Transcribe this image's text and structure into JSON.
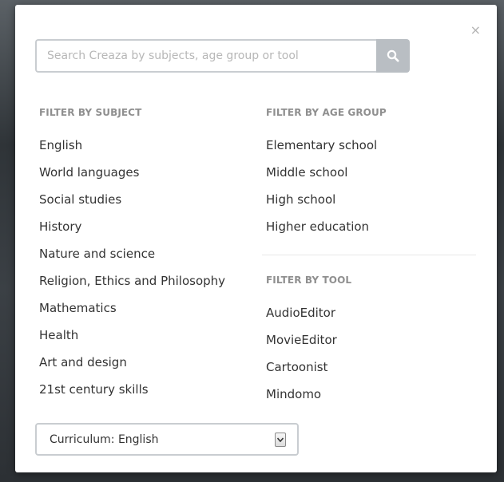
{
  "modal": {
    "close_label": "×",
    "search": {
      "placeholder": "Search Creaza by subjects, age group or tool",
      "value": ""
    },
    "filter_subject": {
      "heading": "FILTER BY SUBJECT",
      "items": [
        "English",
        "World languages",
        "Social studies",
        "History",
        "Nature and science",
        "Religion, Ethics and Philosophy",
        "Mathematics",
        "Health",
        "Art and design",
        "21st century skills"
      ]
    },
    "filter_age": {
      "heading": "FILTER BY AGE GROUP",
      "items": [
        "Elementary school",
        "Middle school",
        "High school",
        "Higher education"
      ]
    },
    "filter_tool": {
      "heading": "FILTER BY TOOL",
      "items": [
        "AudioEditor",
        "MovieEditor",
        "Cartoonist",
        "Mindomo"
      ]
    },
    "curriculum_select": {
      "value": "Curriculum: English"
    }
  },
  "colors": {
    "search_button": "#b9bec3",
    "heading": "#8f8f8f",
    "item_text": "#333333",
    "border": "#c9cdd1"
  },
  "icons": {
    "search": "search-icon",
    "close": "close-icon",
    "select_arrow": "chevron-down-icon"
  }
}
